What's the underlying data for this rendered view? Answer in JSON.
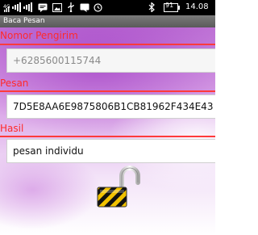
{
  "status_bar": {
    "time": "14.08",
    "battery": "91",
    "icons": [
      "network-type-icon",
      "signal-icon",
      "signal-icon",
      "message-icon",
      "image-icon",
      "usb-icon",
      "chat-icon",
      "alarm-icon",
      "bluetooth-icon",
      "battery-icon"
    ]
  },
  "app": {
    "title": "Baca Pesan"
  },
  "fields": {
    "sender": {
      "label": "Nomor Pengirim",
      "value": "+6285600115744"
    },
    "message": {
      "label": "Pesan",
      "value": "7D5E8AA6E9875806B1CB81962F434E43"
    },
    "result": {
      "label": "Hasil",
      "value": "pesan individu"
    }
  },
  "lock": {
    "icon": "unlocked-padlock-icon",
    "colors": {
      "stripe_yellow": "#f2c200",
      "stripe_black": "#111111",
      "shackle": "#eeeeee"
    }
  },
  "colors": {
    "label": "#ff2a2a",
    "underline": "#ff3b3b",
    "titlebar": "#666666",
    "statusbar": "#000000"
  }
}
